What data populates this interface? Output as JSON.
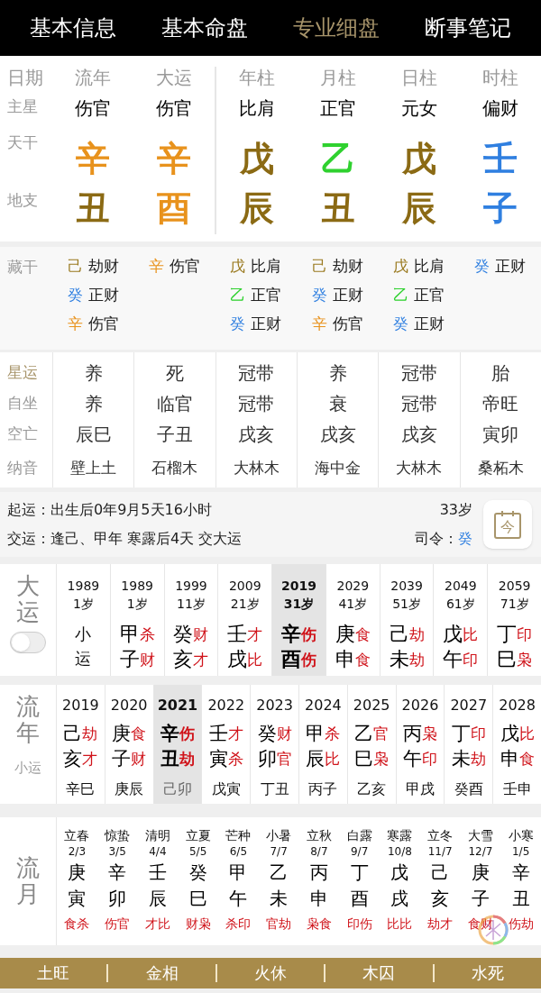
{
  "tabs": [
    {
      "label": "基本信息",
      "selected": false
    },
    {
      "label": "基本命盘",
      "selected": false
    },
    {
      "label": "专业细盘",
      "selected": true
    },
    {
      "label": "断事笔记",
      "selected": false
    }
  ],
  "row_labels": {
    "date": "日期",
    "star": "主星",
    "stem": "天干",
    "branch": "地支",
    "hidden": "藏干",
    "xingyun": "星运",
    "zizuo": "自坐",
    "kongwang": "空亡",
    "nayin": "纳音"
  },
  "pillars": [
    {
      "kind": "transit",
      "header": "流年",
      "star": "伤官",
      "stem": {
        "char": "辛",
        "color": "#e8921c"
      },
      "branch": {
        "char": "丑",
        "color": "#8b6a14"
      },
      "hidden": [
        {
          "stem": "己",
          "color": "#9a7a20",
          "god": "劫财"
        },
        {
          "stem": "癸",
          "color": "#2f7fe0",
          "god": "正财"
        },
        {
          "stem": "辛",
          "color": "#e8921c",
          "god": "伤官"
        }
      ],
      "xingyun": "养",
      "zizuo": "养",
      "kongwang": "辰巳",
      "nayin": "壁上土"
    },
    {
      "kind": "transit",
      "header": "大运",
      "star": "伤官",
      "stem": {
        "char": "辛",
        "color": "#e8921c"
      },
      "branch": {
        "char": "酉",
        "color": "#e8921c"
      },
      "hidden": [
        {
          "stem": "辛",
          "color": "#e8921c",
          "god": "伤官"
        }
      ],
      "xingyun": "死",
      "zizuo": "临官",
      "kongwang": "子丑",
      "nayin": "石榴木"
    },
    {
      "kind": "natal",
      "header": "年柱",
      "star": "比肩",
      "stem": {
        "char": "戊",
        "color": "#8b6a14"
      },
      "branch": {
        "char": "辰",
        "color": "#8b6a14"
      },
      "hidden": [
        {
          "stem": "戊",
          "color": "#9a7a20",
          "god": "比肩"
        },
        {
          "stem": "乙",
          "color": "#2fd12f",
          "god": "正官"
        },
        {
          "stem": "癸",
          "color": "#2f7fe0",
          "god": "正财"
        }
      ],
      "xingyun": "冠带",
      "zizuo": "冠带",
      "kongwang": "戌亥",
      "nayin": "大林木"
    },
    {
      "kind": "natal",
      "header": "月柱",
      "star": "正官",
      "stem": {
        "char": "乙",
        "color": "#2fd12f"
      },
      "branch": {
        "char": "丑",
        "color": "#8b6a14"
      },
      "hidden": [
        {
          "stem": "己",
          "color": "#9a7a20",
          "god": "劫财"
        },
        {
          "stem": "癸",
          "color": "#2f7fe0",
          "god": "正财"
        },
        {
          "stem": "辛",
          "color": "#e8921c",
          "god": "伤官"
        }
      ],
      "xingyun": "养",
      "zizuo": "衰",
      "kongwang": "戌亥",
      "nayin": "海中金"
    },
    {
      "kind": "natal",
      "header": "日柱",
      "star": "元女",
      "stem": {
        "char": "戊",
        "color": "#8b6a14"
      },
      "branch": {
        "char": "辰",
        "color": "#8b6a14"
      },
      "hidden": [
        {
          "stem": "戊",
          "color": "#9a7a20",
          "god": "比肩"
        },
        {
          "stem": "乙",
          "color": "#2fd12f",
          "god": "正官"
        },
        {
          "stem": "癸",
          "color": "#2f7fe0",
          "god": "正财"
        }
      ],
      "xingyun": "冠带",
      "zizuo": "冠带",
      "kongwang": "戌亥",
      "nayin": "大林木"
    },
    {
      "kind": "natal",
      "header": "时柱",
      "star": "偏财",
      "stem": {
        "char": "壬",
        "color": "#2f7fe0"
      },
      "branch": {
        "char": "子",
        "color": "#2f7fe0"
      },
      "hidden": [
        {
          "stem": "癸",
          "color": "#2f7fe0",
          "god": "正财"
        }
      ],
      "xingyun": "胎",
      "zizuo": "帝旺",
      "kongwang": "寅卯",
      "nayin": "桑柘木"
    }
  ],
  "luck_start": {
    "start_label": "起运：",
    "start_text": "出生后0年9月5天16小时",
    "change_label": "交运：",
    "change_text": "逢己、甲年 寒露后4天 交大运",
    "age": "33岁",
    "commander_label": "司令：",
    "commander": "癸",
    "today_button": "今"
  },
  "dayun": {
    "title": "大运",
    "toggle_on": false,
    "columns": [
      {
        "kind": "minor",
        "year": "1989",
        "age": "1岁",
        "text": "小运",
        "selected": false
      },
      {
        "kind": "pillar",
        "year": "1989",
        "age": "1岁",
        "stem": "甲",
        "stem_god": "杀",
        "branch": "子",
        "branch_god": "财",
        "selected": false
      },
      {
        "kind": "pillar",
        "year": "1999",
        "age": "11岁",
        "stem": "癸",
        "stem_god": "财",
        "branch": "亥",
        "branch_god": "才",
        "selected": false
      },
      {
        "kind": "pillar",
        "year": "2009",
        "age": "21岁",
        "stem": "壬",
        "stem_god": "才",
        "branch": "戌",
        "branch_god": "比",
        "selected": false
      },
      {
        "kind": "pillar",
        "year": "2019",
        "age": "31岁",
        "stem": "辛",
        "stem_god": "伤",
        "branch": "酉",
        "branch_god": "伤",
        "selected": true
      },
      {
        "kind": "pillar",
        "year": "2029",
        "age": "41岁",
        "stem": "庚",
        "stem_god": "食",
        "branch": "申",
        "branch_god": "食",
        "selected": false
      },
      {
        "kind": "pillar",
        "year": "2039",
        "age": "51岁",
        "stem": "己",
        "stem_god": "劫",
        "branch": "未",
        "branch_god": "劫",
        "selected": false
      },
      {
        "kind": "pillar",
        "year": "2049",
        "age": "61岁",
        "stem": "戊",
        "stem_god": "比",
        "branch": "午",
        "branch_god": "印",
        "selected": false
      },
      {
        "kind": "pillar",
        "year": "2059",
        "age": "71岁",
        "stem": "丁",
        "stem_god": "印",
        "branch": "巳",
        "branch_god": "枭",
        "selected": false
      }
    ]
  },
  "liunian": {
    "title": "流年",
    "minor_label": "小运",
    "columns": [
      {
        "year": "2019",
        "stem": "己",
        "stem_god": "劫",
        "branch": "亥",
        "branch_god": "才",
        "minor": "辛巳",
        "selected": false
      },
      {
        "year": "2020",
        "stem": "庚",
        "stem_god": "食",
        "branch": "子",
        "branch_god": "财",
        "minor": "庚辰",
        "selected": false
      },
      {
        "year": "2021",
        "stem": "辛",
        "stem_god": "伤",
        "branch": "丑",
        "branch_god": "劫",
        "minor": "己卯",
        "selected": true
      },
      {
        "year": "2022",
        "stem": "壬",
        "stem_god": "才",
        "branch": "寅",
        "branch_god": "杀",
        "minor": "戊寅",
        "selected": false
      },
      {
        "year": "2023",
        "stem": "癸",
        "stem_god": "财",
        "branch": "卯",
        "branch_god": "官",
        "minor": "丁丑",
        "selected": false
      },
      {
        "year": "2024",
        "stem": "甲",
        "stem_god": "杀",
        "branch": "辰",
        "branch_god": "比",
        "minor": "丙子",
        "selected": false
      },
      {
        "year": "2025",
        "stem": "乙",
        "stem_god": "官",
        "branch": "巳",
        "branch_god": "枭",
        "minor": "乙亥",
        "selected": false
      },
      {
        "year": "2026",
        "stem": "丙",
        "stem_god": "枭",
        "branch": "午",
        "branch_god": "印",
        "minor": "甲戌",
        "selected": false
      },
      {
        "year": "2027",
        "stem": "丁",
        "stem_god": "印",
        "branch": "未",
        "branch_god": "劫",
        "minor": "癸酉",
        "selected": false
      },
      {
        "year": "2028",
        "stem": "戊",
        "stem_god": "比",
        "branch": "申",
        "branch_god": "食",
        "minor": "壬申",
        "selected": false
      }
    ]
  },
  "liuyue": {
    "title": "流月",
    "columns": [
      {
        "term": "立春",
        "date": "2/3",
        "stem": "庚",
        "branch": "寅",
        "gods": "食杀"
      },
      {
        "term": "惊蛰",
        "date": "3/5",
        "stem": "辛",
        "branch": "卯",
        "gods": "伤官"
      },
      {
        "term": "清明",
        "date": "4/4",
        "stem": "壬",
        "branch": "辰",
        "gods": "才比"
      },
      {
        "term": "立夏",
        "date": "5/5",
        "stem": "癸",
        "branch": "巳",
        "gods": "财枭"
      },
      {
        "term": "芒种",
        "date": "6/5",
        "stem": "甲",
        "branch": "午",
        "gods": "杀印"
      },
      {
        "term": "小暑",
        "date": "7/7",
        "stem": "乙",
        "branch": "未",
        "gods": "官劫"
      },
      {
        "term": "立秋",
        "date": "8/7",
        "stem": "丙",
        "branch": "申",
        "gods": "枭食"
      },
      {
        "term": "白露",
        "date": "9/7",
        "stem": "丁",
        "branch": "酉",
        "gods": "印伤"
      },
      {
        "term": "寒露",
        "date": "10/8",
        "stem": "戊",
        "branch": "戌",
        "gods": "比比"
      },
      {
        "term": "立冬",
        "date": "11/7",
        "stem": "己",
        "branch": "亥",
        "gods": "劫才"
      },
      {
        "term": "大雪",
        "date": "12/7",
        "stem": "庚",
        "branch": "子",
        "gods": "食财"
      },
      {
        "term": "小寒",
        "date": "1/5",
        "stem": "辛",
        "branch": "丑",
        "gods": "伤劫"
      }
    ]
  },
  "seasons": [
    "土旺",
    "金相",
    "火休",
    "木囚",
    "水死"
  ]
}
